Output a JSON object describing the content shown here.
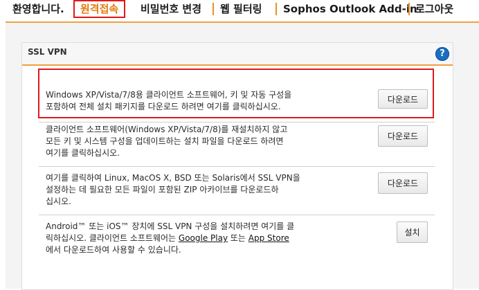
{
  "nav": {
    "items": [
      {
        "label": "환영합니다."
      },
      {
        "label": "원격접속"
      },
      {
        "label": "비밀번호 변경"
      },
      {
        "label": "웹 필터링"
      },
      {
        "label": "Sophos Outlook Add-in"
      },
      {
        "label": "로그아웃"
      }
    ]
  },
  "panel": {
    "title": "SSL VPN",
    "help": "?"
  },
  "rows": [
    {
      "line1": "Windows XP/Vista/7/8용 클라이언트 소프트웨어, 키 및 자동 구성을",
      "line2": "포함하여 전체 설치 패키지를 다운로드 하려면 여기를 클릭하십시오.",
      "button": "다운로드"
    },
    {
      "line1": "클라이언트 소프트웨어(Windows XP/Vista/7/8)를 재설치하지 않고",
      "line2": "모든 키 및 시스템 구성을 업데이트하는 설치 파일을 다운로드 하려면",
      "line3": "여기를 클릭하십시오.",
      "button": "다운로드"
    },
    {
      "line1": "여기를 클릭하여 Linux, MacOS X, BSD 또는 Solaris에서 SSL VPN을",
      "line2": "설정하는 데 필요한 모든 파일이 포함된 ZIP 아카이브를 다운로드하",
      "line3": "십시오.",
      "button": "다운로드"
    },
    {
      "line1": "Android™ 또는 iOS™ 장치에 SSL VPN 구성을 설치하려면 여기를 클",
      "line2_a": "릭하십시오. 클라이언트 소프트웨어는 ",
      "line2_link1": "Google Play",
      "line2_b": " 또는 ",
      "line2_link2": "App Store",
      "line3": "에서 다운로드하여 사용할 수 있습니다.",
      "button": "설치"
    }
  ],
  "colors": {
    "accent": "#f0a040",
    "highlight": "#e01818",
    "help_icon": "#1a6fc0"
  }
}
